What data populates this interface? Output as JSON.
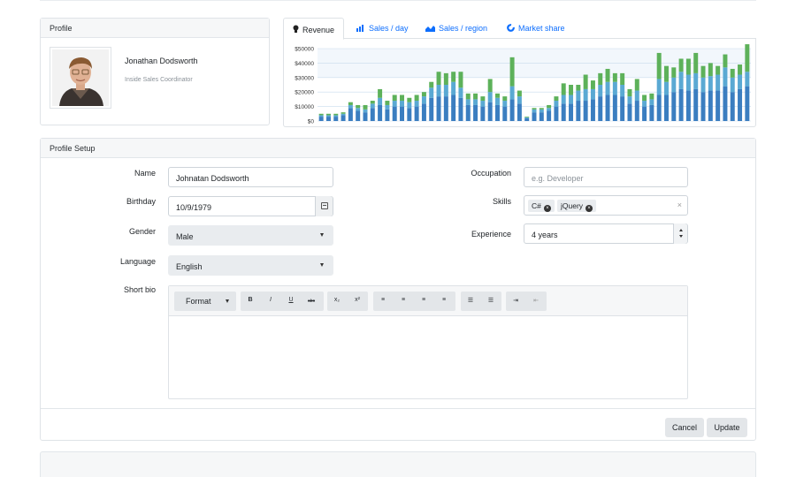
{
  "profile": {
    "header": "Profile",
    "name": "Jonathan Dodsworth",
    "role": "Inside Sales Coordinator"
  },
  "chart_tabs": [
    {
      "label": "Revenue",
      "icon": "lightbulb-icon",
      "active": true
    },
    {
      "label": "Sales / day",
      "icon": "bar-chart-icon"
    },
    {
      "label": "Sales / region",
      "icon": "area-chart-icon"
    },
    {
      "label": "Market share",
      "icon": "donut-chart-icon"
    }
  ],
  "chart_data": {
    "type": "bar",
    "stacked": true,
    "yticks": [
      "$0",
      "$10000",
      "$20000",
      "$30000",
      "$40000",
      "$50000"
    ],
    "ylim": [
      0,
      50000
    ],
    "grid": true,
    "series": [
      {
        "color": "#3b7ec0",
        "values": [
          3000,
          3000,
          3000,
          4000,
          9000,
          7000,
          6000,
          9000,
          11000,
          8000,
          10000,
          10000,
          9000,
          10000,
          12000,
          16000,
          17000,
          17000,
          18000,
          16000,
          11000,
          11000,
          10000,
          13000,
          11000,
          10000,
          15000,
          12000,
          2000,
          6000,
          6000,
          7000,
          10000,
          12000,
          12000,
          14000,
          14000,
          15000,
          17000,
          18000,
          18000,
          17000,
          12000,
          14000,
          10000,
          11000,
          18000,
          18000,
          20000,
          22000,
          21000,
          22000,
          20000,
          21000,
          21000,
          24000,
          20000,
          22000,
          24000
        ]
      },
      {
        "color": "#5aa9d3",
        "values": [
          1000,
          1000,
          1000,
          1000,
          2000,
          2000,
          2000,
          3000,
          5000,
          3000,
          4000,
          4000,
          4000,
          4000,
          5000,
          7000,
          8000,
          8000,
          9000,
          7000,
          4000,
          4000,
          4000,
          7000,
          5000,
          4000,
          9000,
          5000,
          500,
          2000,
          2000,
          2000,
          4000,
          6000,
          6000,
          7000,
          8000,
          7000,
          8000,
          9000,
          9000,
          8000,
          5000,
          7000,
          4000,
          4000,
          11000,
          9000,
          10000,
          12000,
          11000,
          11000,
          10000,
          10000,
          11000,
          13000,
          10000,
          10000,
          10000
        ]
      },
      {
        "color": "#5db15a",
        "values": [
          1000,
          1000,
          1000,
          1000,
          2000,
          2000,
          3000,
          2000,
          6000,
          3000,
          4000,
          4000,
          3000,
          4000,
          3000,
          4000,
          9000,
          8000,
          7000,
          11000,
          4000,
          4000,
          3000,
          9000,
          3000,
          3000,
          20000,
          4000,
          500,
          1000,
          1000,
          2000,
          3000,
          8000,
          7000,
          4000,
          10000,
          6000,
          8000,
          9000,
          6000,
          8000,
          5000,
          8000,
          4000,
          4000,
          18000,
          11000,
          7000,
          9000,
          11000,
          14000,
          8000,
          9000,
          6000,
          9000,
          6000,
          7000,
          19000
        ]
      }
    ]
  },
  "setup": {
    "header": "Profile Setup",
    "name_label": "Name",
    "name_value": "Johnatan Dodsworth",
    "birthday_label": "Birthday",
    "birthday_value": "10/9/1979",
    "gender_label": "Gender",
    "gender_value": "Male",
    "language_label": "Language",
    "language_value": "English",
    "bio_label": "Short bio",
    "occupation_label": "Occupation",
    "occupation_placeholder": "e.g. Developer",
    "skills_label": "Skills",
    "skills": [
      "C#",
      "jQuery"
    ],
    "experience_label": "Experience",
    "experience_value": "4 years",
    "toolbar": {
      "format_label": "Format",
      "bold": "B",
      "italic": "I",
      "underline": "U",
      "strike": "abc",
      "subscript": "x₂",
      "superscript": "x²"
    },
    "cancel_label": "Cancel",
    "update_label": "Update"
  }
}
